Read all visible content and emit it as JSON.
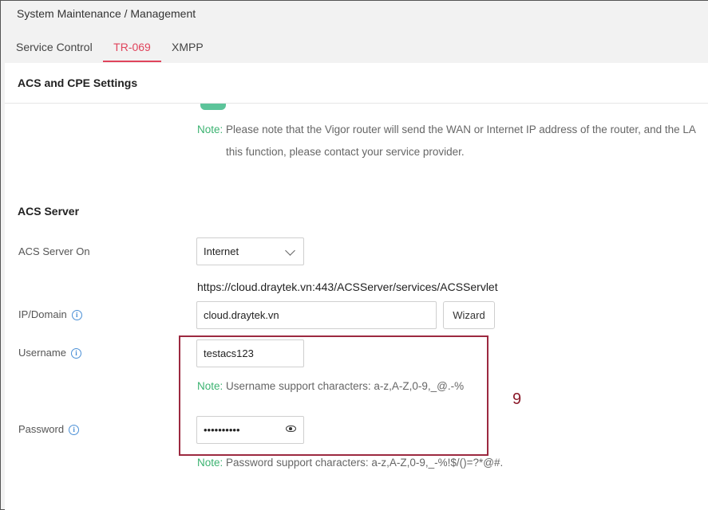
{
  "breadcrumb": "System Maintenance / Management",
  "tabs": [
    {
      "label": "Service Control"
    },
    {
      "label": "TR-069"
    },
    {
      "label": "XMPP"
    }
  ],
  "acs_cpe": {
    "title": "ACS and CPE Settings",
    "note_label": "Note:",
    "note_line1": "Please note that the Vigor router will send the WAN or Internet IP address of the router, and the LA",
    "note_line2": "this function, please contact your service provider."
  },
  "acs_server": {
    "title": "ACS Server",
    "server_on_label": "ACS Server On",
    "server_on_value": "Internet",
    "url": "https://cloud.draytek.vn:443/ACSServer/services/ACSServlet",
    "ip_domain_label": "IP/Domain",
    "ip_domain_value": "cloud.draytek.vn",
    "wizard_label": "Wizard",
    "username_label": "Username",
    "username_value": "testacs123",
    "username_note_label": "Note:",
    "username_note": "Username support characters: a-z,A-Z,0-9,_@.-%",
    "password_label": "Password",
    "password_value": "••••••••••",
    "password_note_label": "Note:",
    "password_note": "Password support characters: a-z,A-Z,0-9,_-%!$/()=?*@#."
  },
  "annotation": "9",
  "icons": [
    "info-icon",
    "chevron-down-icon",
    "eye-icon"
  ],
  "colors": {
    "accent": "#e0445c",
    "note": "#3cb371",
    "highlight": "#9c2940"
  }
}
